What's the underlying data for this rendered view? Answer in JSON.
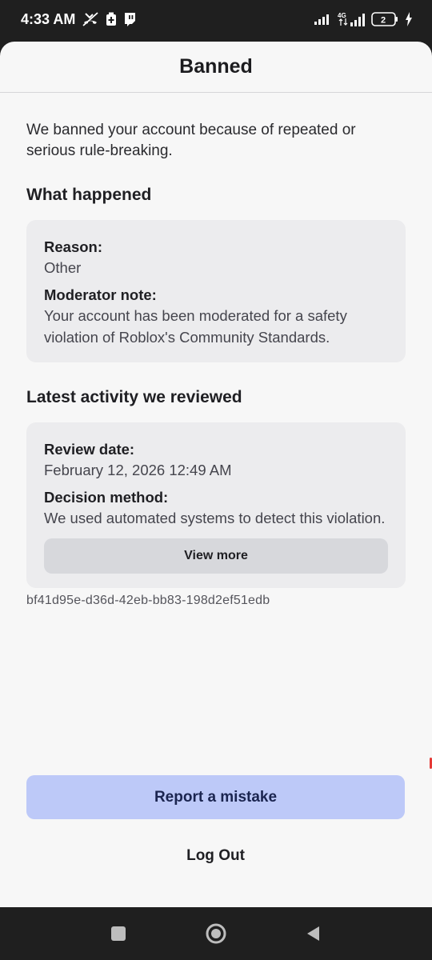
{
  "status_bar": {
    "time": "4:33 AM",
    "icons": [
      "missed-call-icon",
      "battery-saver-icon",
      "twitch-icon",
      "signal-icon",
      "4g-signal-icon",
      "battery-icon",
      "charging-icon"
    ],
    "network_label": "4G",
    "battery_level": "2"
  },
  "sheet": {
    "title": "Banned"
  },
  "content": {
    "intro": "We banned your account because of repeated or serious rule-breaking.",
    "what_happened": {
      "heading": "What happened",
      "reason_label": "Reason:",
      "reason_value": "Other",
      "note_label": "Moderator note:",
      "note_value": "Your account has been moderated for a safety violation of Roblox's Community Standards."
    },
    "latest_activity": {
      "heading": "Latest activity we reviewed",
      "review_date_label": "Review date:",
      "review_date_value": "February 12, 2026 12:49 AM",
      "decision_label": "Decision method:",
      "decision_value": "We used automated systems to detect this violation.",
      "view_more_label": "View more"
    },
    "reference_id": "bf41d95e-d36d-42eb-bb83-198d2ef51edb"
  },
  "actions": {
    "report_label": "Report a mistake",
    "logout_label": "Log Out"
  },
  "nav": {
    "icons": [
      "recents-square-icon",
      "home-circle-icon",
      "back-triangle-icon"
    ]
  },
  "colors": {
    "sheet_bg": "#f7f7f7",
    "card_bg": "#ececee",
    "primary_button": "#bdc9f8",
    "primary_text": "#1b2550",
    "system_bar": "#1f1f1f"
  }
}
